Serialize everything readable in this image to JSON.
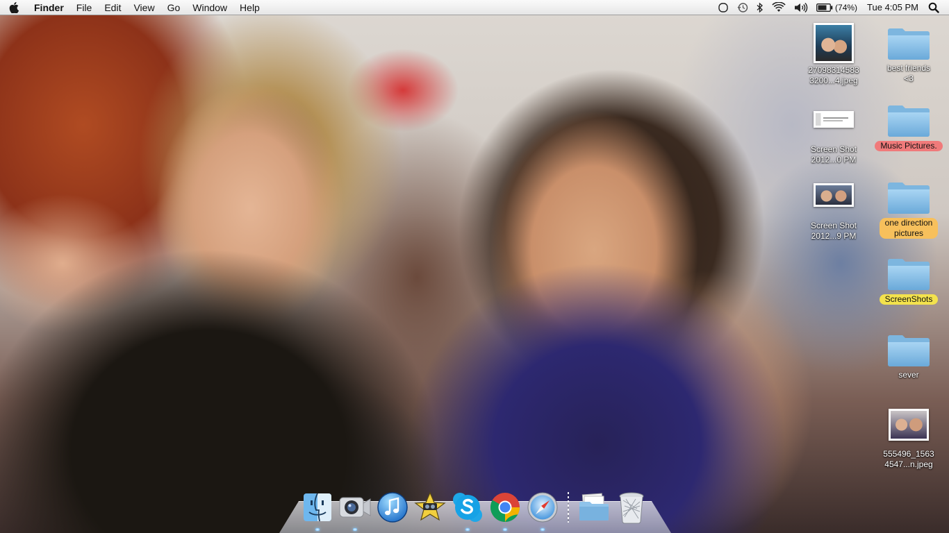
{
  "menubar": {
    "apple_icon": "apple-icon",
    "app_name": "Finder",
    "menus": [
      "File",
      "Edit",
      "View",
      "Go",
      "Window",
      "Help"
    ],
    "status": {
      "battery_percent": "(74%)",
      "clock": "Tue 4:05 PM"
    }
  },
  "desktop": {
    "items": [
      {
        "label_line1": "27098314583",
        "label_line2": "3200...4.jpeg",
        "kind": "image"
      },
      {
        "label_line1": "best friends",
        "label_line2": "<3",
        "kind": "folder"
      },
      {
        "label_line1": "Screen Shot",
        "label_line2": "2012...0 PM",
        "kind": "image"
      },
      {
        "label_line1": "Music Pictures.",
        "label_line2": "",
        "kind": "folder",
        "tag": "#f07a7a"
      },
      {
        "label_line1": "Screen Shot",
        "label_line2": "2012...9 PM",
        "kind": "image"
      },
      {
        "label_line1": "one direction",
        "label_line2": "pictures",
        "kind": "folder",
        "tag": "#f7c05c"
      },
      {
        "label_line1": "ScreenShots",
        "label_line2": "",
        "kind": "folder",
        "tag": "#f3e24d"
      },
      {
        "label_line1": "sever",
        "label_line2": "",
        "kind": "folder"
      },
      {
        "label_line1": "555496_1563",
        "label_line2": "4547...n.jpeg",
        "kind": "image"
      }
    ]
  },
  "dock": {
    "apps": [
      "finder-icon",
      "photo-booth-icon",
      "itunes-icon",
      "imovie-icon",
      "skype-icon",
      "chrome-icon",
      "safari-icon"
    ],
    "others": [
      "documents-stack-icon",
      "trash-icon"
    ]
  },
  "colors": {
    "folder_blue": "#8ec3ea",
    "tag_red": "#f07a7a",
    "tag_orange": "#f7c05c",
    "tag_yellow": "#f3e24d"
  }
}
